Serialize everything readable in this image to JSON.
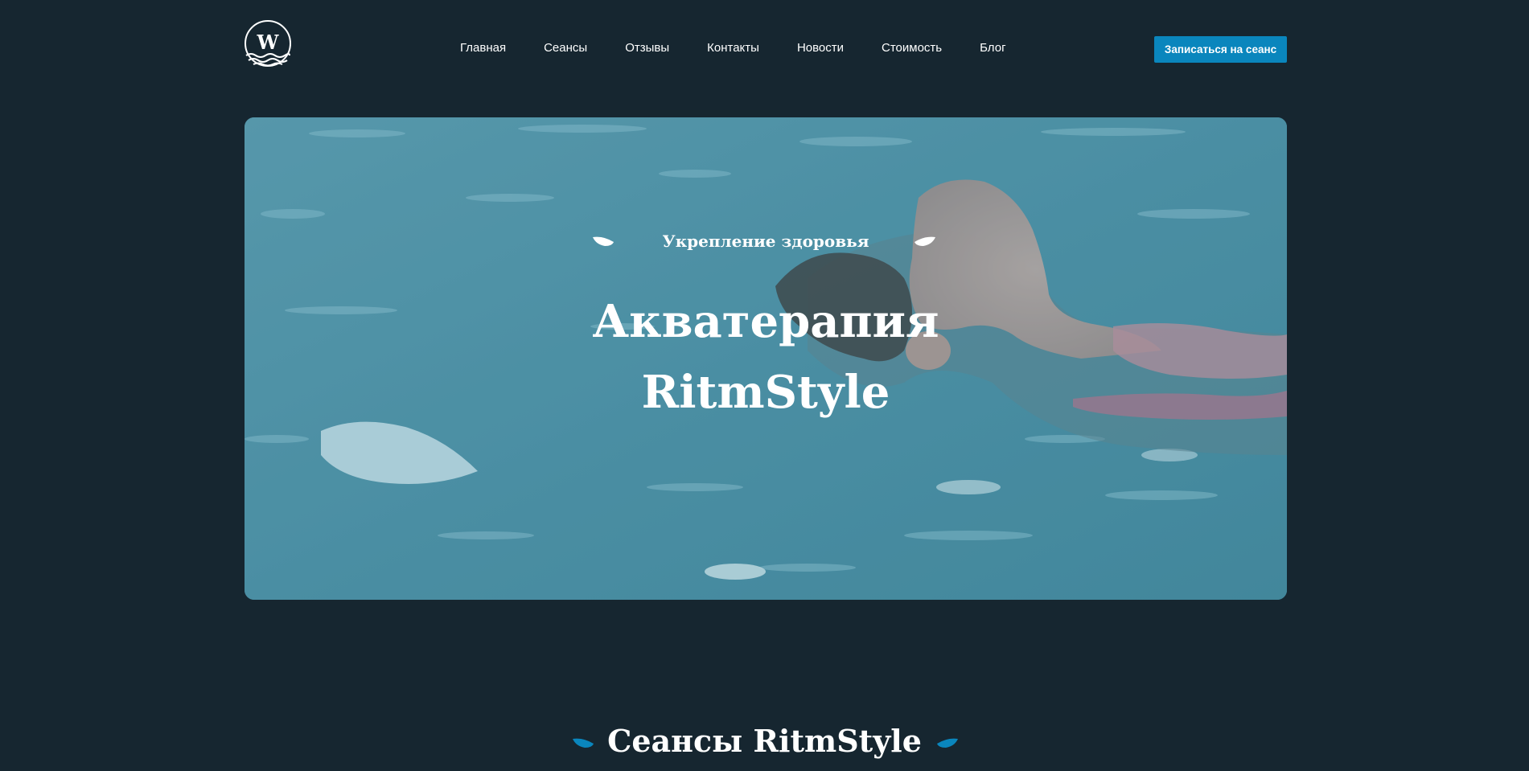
{
  "brand": {
    "logo_letter": "W",
    "logo_icon": "wave-emblem-icon"
  },
  "nav": {
    "items": [
      {
        "label": "Главная"
      },
      {
        "label": "Сеансы"
      },
      {
        "label": "Отзывы"
      },
      {
        "label": "Контакты"
      },
      {
        "label": "Новости"
      },
      {
        "label": "Стоимость"
      },
      {
        "label": "Блог"
      }
    ]
  },
  "header": {
    "cta_label": "Записаться на сеанс"
  },
  "hero": {
    "subtitle": "Укрепление здоровья",
    "title_line1": "Акватерапия",
    "title_line2": "RitmStyle",
    "decor_icon": "leaf-icon",
    "image_subject": "woman-floating-in-water"
  },
  "sessions": {
    "title": "Сеансы RitmStyle"
  },
  "colors": {
    "page_background": "#162630",
    "accent": "#0a86bd",
    "hero_overlay": "#4d8fa2",
    "text": "#ffffff"
  }
}
